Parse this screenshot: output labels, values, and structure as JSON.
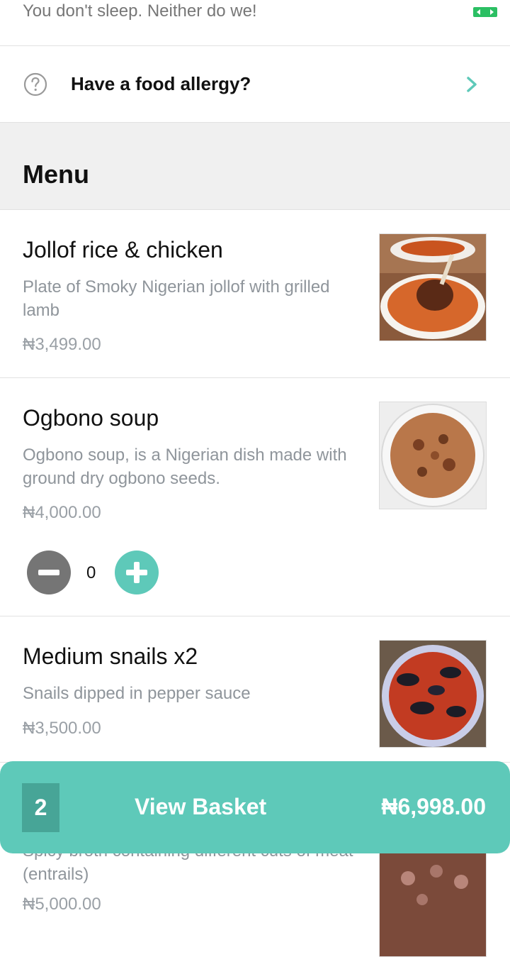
{
  "banner": {
    "text": "You don't sleep. Neither do we!"
  },
  "allergy": {
    "label": "Have a food allergy?"
  },
  "menu": {
    "title": "Menu",
    "items": [
      {
        "name": "Jollof rice & chicken",
        "description": "Plate of Smoky Nigerian  jollof with grilled lamb",
        "price": "₦3,499.00"
      },
      {
        "name": "Ogbono soup",
        "description": "Ogbono soup, is a Nigerian dish made with ground dry ogbono seeds.",
        "price": "₦4,000.00",
        "quantity": "0"
      },
      {
        "name": "Medium snails x2",
        "description": "Snails dipped in pepper sauce",
        "price": "₦3,500.00"
      },
      {
        "name": "",
        "description": "Spicy broth containing different cuts of meat (entrails)",
        "price": "₦5,000.00"
      }
    ]
  },
  "basket": {
    "count": "2",
    "label": "View Basket",
    "total": "₦6,998.00"
  },
  "colors": {
    "accent": "#5ec9b9",
    "accent_dark": "#47a597",
    "muted": "#8f959b"
  }
}
